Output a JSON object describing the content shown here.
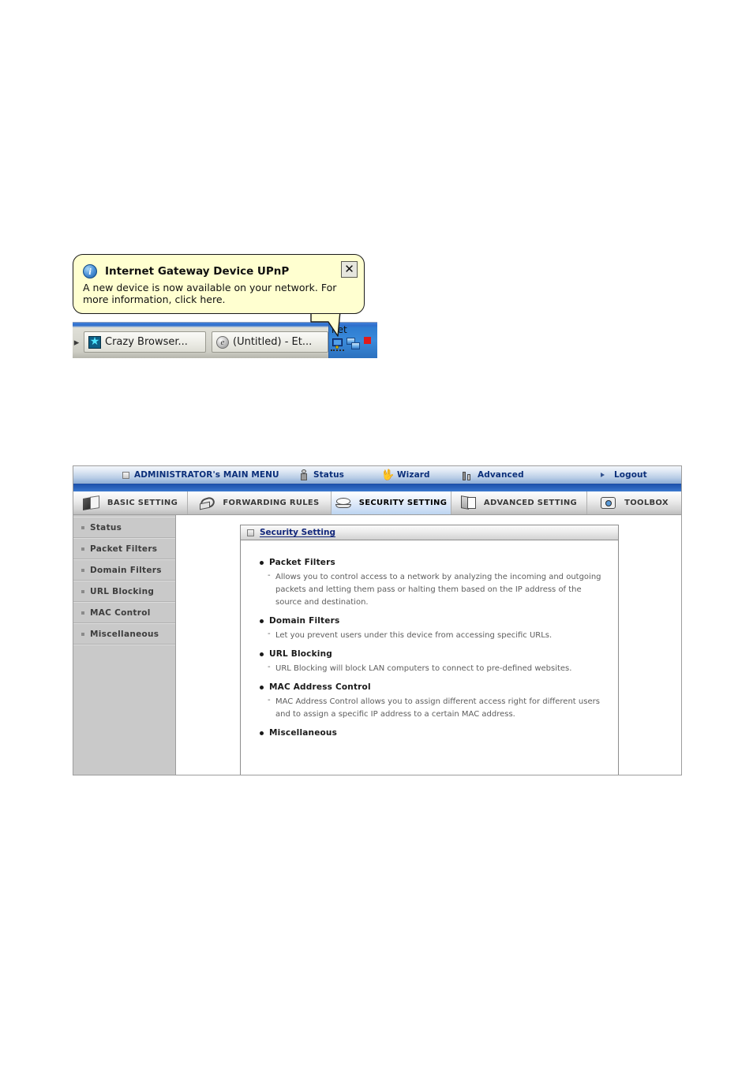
{
  "balloon": {
    "title": "Internet Gateway Device UPnP",
    "body": "A new device is now available on your network. For more information, click here.",
    "close_label": "✕",
    "info_icon": "info-icon"
  },
  "taskbar": {
    "left_edge_glyph": "▸",
    "buttons": [
      {
        "label": "Crazy Browser...",
        "icon": "star-icon"
      },
      {
        "label": "(Untitled) - Et...",
        "icon": "globe-icon"
      }
    ],
    "tray": {
      "partial_text": "net",
      "icons": [
        "network-computer-icon",
        "two-computers-icon",
        "red-flag-icon"
      ]
    }
  },
  "router": {
    "topnav": [
      {
        "label": "ADMINISTRATOR's MAIN MENU",
        "icon": "square-icon"
      },
      {
        "label": "Status",
        "icon": "person-icon"
      },
      {
        "label": "Wizard",
        "icon": "wand-icon"
      },
      {
        "label": "Advanced",
        "icon": "chart-icon"
      },
      {
        "label": "Logout",
        "icon": "triangle-right-icon"
      }
    ],
    "tabs": [
      {
        "label": "BASIC SETTING",
        "icon": "book-icon",
        "active": false
      },
      {
        "label": "FORWARDING RULES",
        "icon": "loop-icon",
        "active": false
      },
      {
        "label": "SECURITY SETTING",
        "icon": "shield-icon",
        "active": true
      },
      {
        "label": "ADVANCED SETTING",
        "icon": "box-icon",
        "active": false
      },
      {
        "label": "TOOLBOX",
        "icon": "tools-icon",
        "active": false
      }
    ],
    "sidebar": [
      {
        "label": "Status"
      },
      {
        "label": "Packet Filters"
      },
      {
        "label": "Domain Filters"
      },
      {
        "label": "URL Blocking"
      },
      {
        "label": "MAC Control"
      },
      {
        "label": "Miscellaneous"
      }
    ],
    "panel": {
      "title": "Security Setting",
      "sections": [
        {
          "title": "Packet Filters",
          "desc": "Allows you to control access to a network by analyzing the incoming and outgoing packets and letting them pass or halting them based on the IP address of the source and destination."
        },
        {
          "title": "Domain Filters",
          "desc": "Let you prevent users under this device from accessing specific URLs."
        },
        {
          "title": "URL Blocking",
          "desc": "URL Blocking will block LAN computers to connect to pre-defined websites."
        },
        {
          "title": "MAC Address Control",
          "desc": "MAC Address Control allows you to assign different access right for different users and to assign a specific IP address to a certain MAC address."
        },
        {
          "title": "Miscellaneous",
          "desc": ""
        }
      ]
    }
  },
  "colors": {
    "balloon_bg": "#ffffd0",
    "nav_blue": "#1b4fa8",
    "link_blue": "#12267a",
    "active_tab": "#cfe0f6",
    "sidebar_bg": "#c9c9c9"
  }
}
